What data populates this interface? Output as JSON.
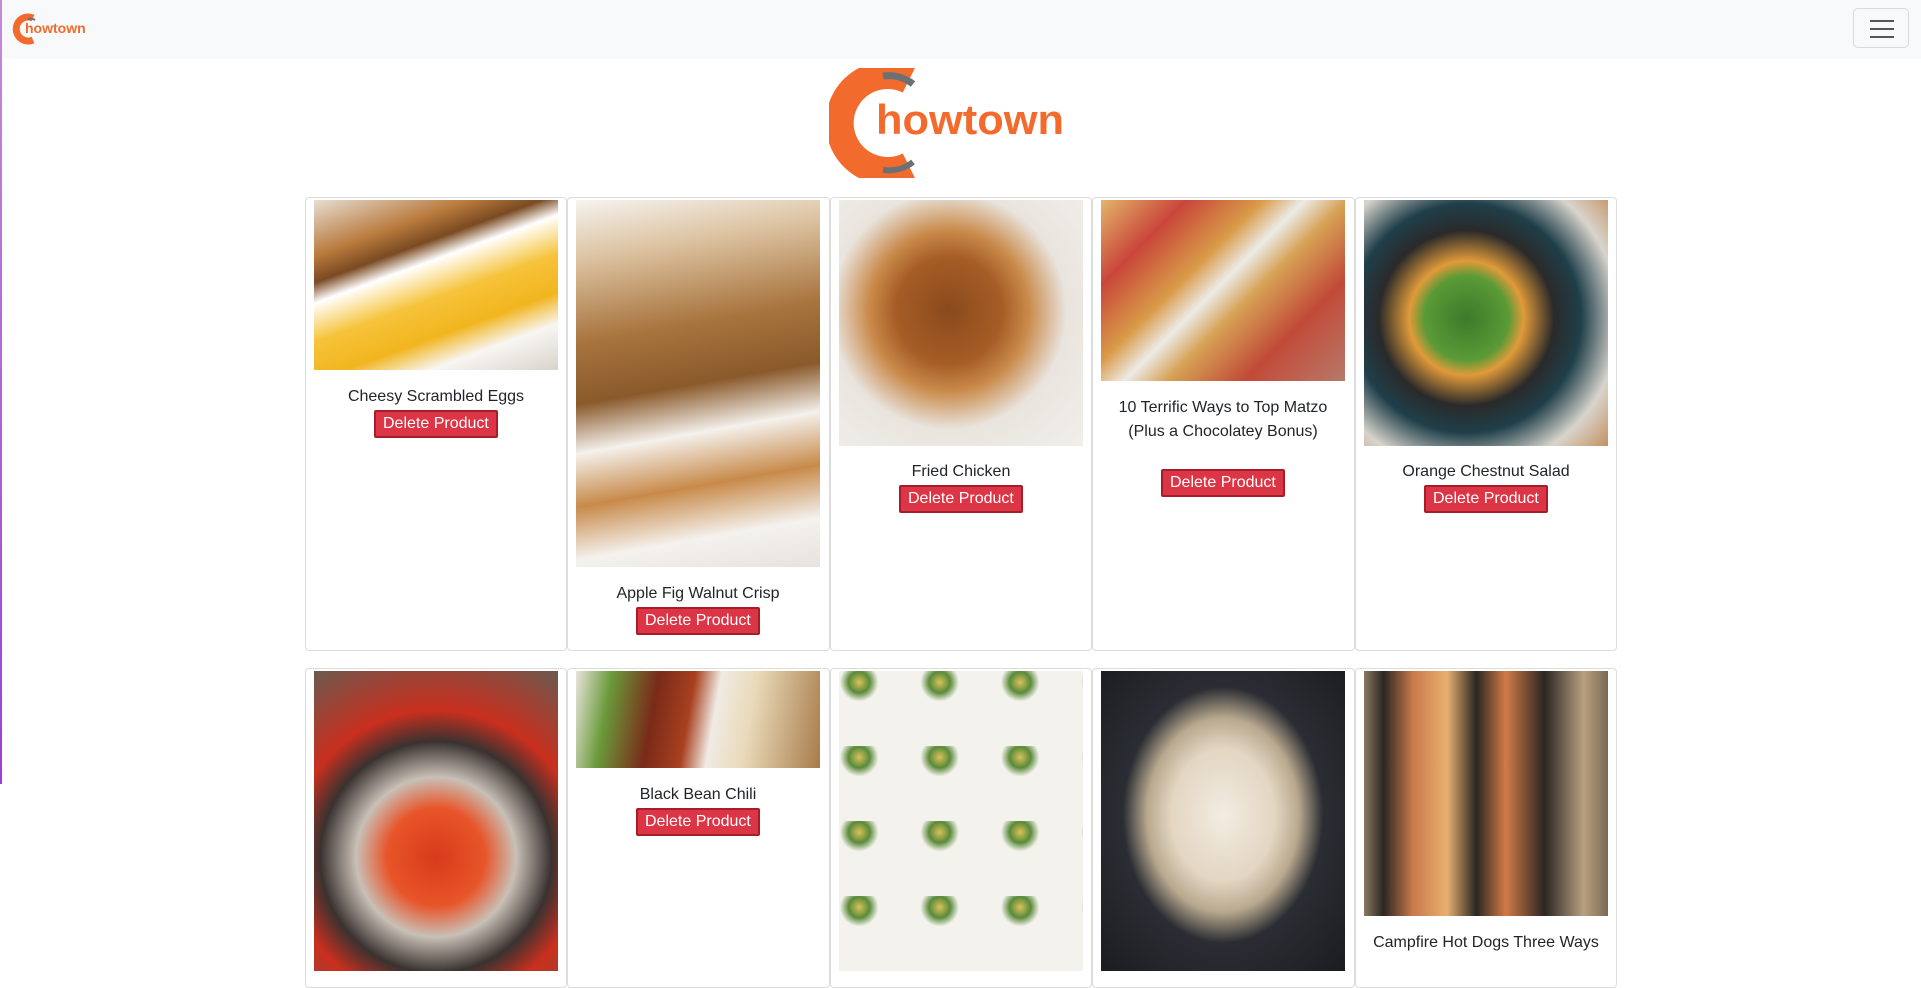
{
  "brand": {
    "name": "Chowtown",
    "logo_letter": "C",
    "logo_rest": "howtown",
    "accent": "#f26b2c",
    "dark": "#6b7075"
  },
  "navbar": {
    "toggle_icon": "hamburger-icon"
  },
  "delete_color": "#dc3545",
  "products": [
    {
      "name": "Cheesy Scrambled Eggs",
      "button": "Delete Product"
    },
    {
      "name": "Apple Fig Walnut Crisp",
      "button": "Delete Product"
    },
    {
      "name": "Fried Chicken",
      "button": "Delete Product"
    },
    {
      "name": "10 Terrific Ways to Top Matzo (Plus a Chocolatey Bonus)",
      "button": "Delete Product"
    },
    {
      "name": "Orange Chestnut Salad",
      "button": "Delete Product"
    },
    {
      "name": "",
      "button": ""
    },
    {
      "name": "Black Bean Chili",
      "button": "Delete Product"
    },
    {
      "name": "",
      "button": ""
    },
    {
      "name": "",
      "button": ""
    },
    {
      "name": "Campfire Hot Dogs Three Ways",
      "button": ""
    }
  ]
}
